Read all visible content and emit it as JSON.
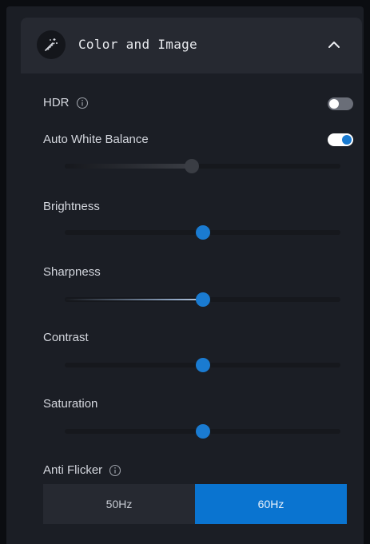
{
  "header": {
    "title": "Color and Image",
    "icon": "magic-wand-icon",
    "expand_icon": "chevron-up-icon"
  },
  "settings": {
    "hdr": {
      "label": "HDR",
      "enabled": false,
      "info_icon": "info-icon"
    },
    "awb": {
      "label": "Auto White Balance",
      "enabled": true,
      "level": 0.46
    },
    "brightness": {
      "label": "Brightness",
      "level": 0.5
    },
    "sharpness": {
      "label": "Sharpness",
      "level": 0.5
    },
    "contrast": {
      "label": "Contrast",
      "level": 0.5
    },
    "saturation": {
      "label": "Saturation",
      "level": 0.5
    },
    "anti_flicker": {
      "label": "Anti Flicker",
      "info_icon": "info-icon",
      "options": [
        "50Hz",
        "60Hz"
      ],
      "selected": "60Hz"
    }
  },
  "colors": {
    "accent": "#0a74d0",
    "panel": "#1b1e25",
    "header": "#262931",
    "background": "#0b0d11"
  }
}
